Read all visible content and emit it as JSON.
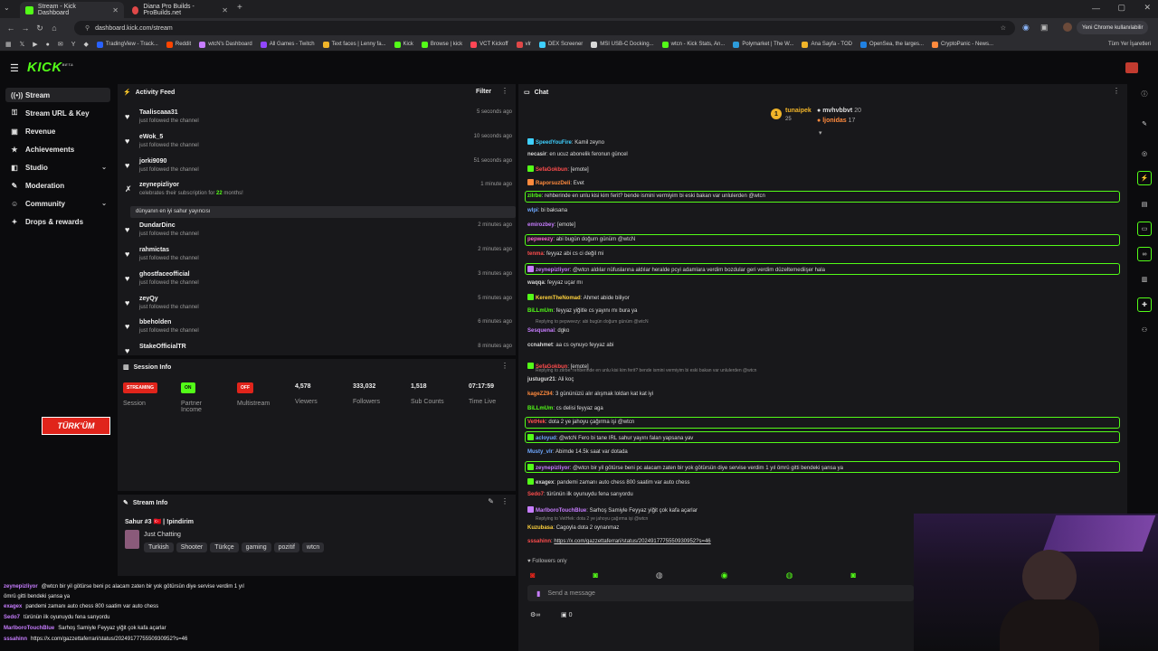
{
  "browser": {
    "tabs": [
      {
        "label": "Stream - Kick Dashboard",
        "active": true,
        "color": "#53fc18"
      },
      {
        "label": "Diana Pro Builds - ProBuilds.net",
        "active": false,
        "color": "#e04848"
      }
    ],
    "url": "dashboard.kick.com/stream",
    "profile_label": "Yeni Chrome kullanılabilir",
    "bookmarks": [
      "TradingView - Track...",
      "Reddit",
      "wtcN's Dashboard",
      "All Games - Twitch",
      "Text faces | Lenny fa...",
      "Kick",
      "Browse | kick",
      "VCT Kickoff",
      "vlr",
      "DEX Screener",
      "MSI USB-C Docking...",
      "wtcn - Kick Stats, An...",
      "Polymarket | The W...",
      "Ana Sayfa - TOD",
      "OpenSea, the larges...",
      "CryptoPanic - News..."
    ],
    "bookmarks_all": "Tüm Yer İşaretleri"
  },
  "app": {
    "logo": "KICK",
    "logo_sup": "BETA",
    "accent": "#53fc18"
  },
  "sidebar": {
    "items": [
      {
        "label": "Stream",
        "icon": "broadcast-icon",
        "glyph": "((•))",
        "selected": true
      },
      {
        "label": "Stream URL & Key",
        "icon": "key-icon",
        "glyph": "⚿"
      },
      {
        "label": "Revenue",
        "icon": "wallet-icon",
        "glyph": "▣"
      },
      {
        "label": "Achievements",
        "icon": "trophy-icon",
        "glyph": "★"
      },
      {
        "label": "Studio",
        "icon": "studio-icon",
        "glyph": "◧",
        "chevron": true
      },
      {
        "label": "Moderation",
        "icon": "sword-icon",
        "glyph": "✎"
      },
      {
        "label": "Community",
        "icon": "community-icon",
        "glyph": "☺",
        "chevron": true
      },
      {
        "label": "Drops & rewards",
        "icon": "gift-icon",
        "glyph": "✦"
      }
    ]
  },
  "activity_feed": {
    "title": "Activity Feed",
    "filter_label": "Filter",
    "entries": [
      {
        "name": "Taaliscaaa31",
        "sub": "just followed the channel",
        "time": "5 seconds ago"
      },
      {
        "name": "eWok_5",
        "sub": "just followed the channel",
        "time": "10 seconds ago"
      },
      {
        "name": "jorki9090",
        "sub": "just followed the channel",
        "time": "51 seconds ago"
      },
      {
        "name": "zeynepizliyor",
        "sub": "celebrates their subscription for",
        "sub_months": "22",
        "sub_suffix": "months!",
        "time": "1 minute ago",
        "message": "dünyanın en iyi sahur yayıncısı"
      },
      {
        "name": "DundarDinc",
        "sub": "just followed the channel",
        "time": "2 minutes ago"
      },
      {
        "name": "rahmictas",
        "sub": "just followed the channel",
        "time": "2 minutes ago"
      },
      {
        "name": "ghostfaceofficial",
        "sub": "just followed the channel",
        "time": "3 minutes ago"
      },
      {
        "name": "zeyQy",
        "sub": "just followed the channel",
        "time": "5 minutes ago"
      },
      {
        "name": "bbeholden",
        "sub": "just followed the channel",
        "time": "6 minutes ago"
      },
      {
        "name": "StakeOfficialTR",
        "sub": "",
        "time": "8 minutes ago"
      }
    ]
  },
  "session_info": {
    "title": "Session Info",
    "session": {
      "badge": "STREAMING",
      "label": "Session"
    },
    "partner": {
      "badge": "ON",
      "label": "Partner Income"
    },
    "multistream": {
      "badge": "OFF",
      "label": "Multistream"
    },
    "viewers": {
      "value": "4,578",
      "label": "Viewers"
    },
    "followers": {
      "value": "333,032",
      "label": "Followers"
    },
    "subs": {
      "value": "1,518",
      "label": "Sub Counts"
    },
    "time_live": {
      "value": "07:17:59",
      "label": "Time Live"
    }
  },
  "stream_info": {
    "title": "Stream Info",
    "stream_title": "Sahur #3 🇹🇷 | !pindirim",
    "category": "Just Chatting",
    "tags": [
      "Turkish",
      "Shooter",
      "Türkçe",
      "gaming",
      "pozitif",
      "wtcn"
    ]
  },
  "chat": {
    "title": "Chat",
    "top_gifters": [
      {
        "rank": "1",
        "name": "tunaipek",
        "count": "25"
      },
      {
        "name": "mvhvbbvt",
        "count": "20"
      },
      {
        "name": "ljonidas",
        "count": "17"
      }
    ],
    "messages": [
      {
        "user": "SpeedYouFire",
        "color": "#3fd0ff",
        "text": "Kamil zeyno"
      },
      {
        "user": "necasir",
        "color": "#d8d8d8",
        "text": "en ucuz abonelik feronun güncel"
      },
      {
        "user": "SefaGokbun",
        "color": "#ff4d4d",
        "text": "[emote]"
      },
      {
        "user": "RaporsuzDeli",
        "color": "#ff8a3d",
        "text": "Evet"
      },
      {
        "user": "zilrbe",
        "color": "#53fc18",
        "text": "rehberinde en unlu kisi kim ferit? bende ismini vermiyim bi eski bakan var unlulerden @wtcn",
        "highlight": true
      },
      {
        "user": "wlpi",
        "color": "#6fa8ff",
        "text": "bi baksana"
      },
      {
        "user": "emirozbey",
        "color": "#c77dff",
        "text": "[emote]"
      },
      {
        "user": "pepweezy",
        "color": "#ff66cc",
        "text": "abi bugün doğum günüm @wtcN",
        "highlight": true
      },
      {
        "user": "tenma",
        "color": "#ff4d4d",
        "text": "feyyaz abi cs ci değil mi"
      },
      {
        "user": "zeynepizliyor",
        "color": "#c77dff",
        "text": "@wtcn aldılar nüfuslarına aldılar heralde pcyi adamlara verdim bozdular geri verdim düzeltemediişer hala",
        "highlight": true
      },
      {
        "user": "waqqa",
        "color": "#d8d8d8",
        "text": "feyyaz uçar mı"
      },
      {
        "user": "KeremTheNomad",
        "color": "#ffd23d",
        "text": "Ahmet abide biliyor"
      },
      {
        "user": "BiLLmUm",
        "color": "#53fc18",
        "text": "feyyaz yiğitle cs yayını mı bura ya"
      },
      {
        "user": "Sesquenai",
        "color": "#c77dff",
        "text": "dgko",
        "reply": "Replying to pepweezy: abi bugün doğum günüm @wtcN"
      },
      {
        "user": "ccnahmet",
        "color": "#d8d8d8",
        "text": "aa cs oynuyo feyyaz abi"
      },
      {
        "user": "SefaGokbun",
        "color": "#ff4d4d",
        "text": "[emote]"
      },
      {
        "user": "justugur21",
        "color": "#d8d8d8",
        "text": "Ali koç",
        "reply": "Replying to zilrbe: rehberinde en unlu kisi kim ferit? bende ismini vermiyim bi eski bakan var unlulerden @wtcn"
      },
      {
        "user": "kageZZ94",
        "color": "#ff8a3d",
        "text": "3 gününüzü alır alışmak loldan kat kat iyi"
      },
      {
        "user": "BiLLmUm",
        "color": "#53fc18",
        "text": "cs delisi feyyaz aga"
      },
      {
        "user": "VetHek",
        "color": "#ff4d4d",
        "text": "dota 2 ye jahoyu çağırma işi @wtcn",
        "highlight": true
      },
      {
        "user": "acloyud",
        "color": "#6fa8ff",
        "text": "@wtcN Fero bi tane IRL sahur yayını falan yapsana yav",
        "highlight": true
      },
      {
        "user": "Musty_vlr",
        "color": "#6fa8ff",
        "text": "Abimde 14.5k saat var dotada"
      },
      {
        "user": "zeynepizliyor",
        "color": "#c77dff",
        "text": "@wtcn bir yil götürse beni pc alacam zaten bir yok götürsün diye servise verdim 1 yıl ömrü gitti bendeki şansa ya",
        "highlight": true
      },
      {
        "user": "exagex",
        "color": "#d8d8d8",
        "text": "pandemi zamanı auto chess 800 saatim var auto chess"
      },
      {
        "user": "Sedo7",
        "color": "#ff4d4d",
        "text": "türünün ilk oyunuydu fena sarıyordu"
      },
      {
        "user": "MarlboroTouchBlue",
        "color": "#c77dff",
        "text": "Sarhoş Samiyle Feyyaz yiğit çok kafa açarlar"
      },
      {
        "user": "Kuzubasa",
        "color": "#ffd23d",
        "text": "Cagoyla dota 2 oynanmaz",
        "reply": "Replying to VetHek: dota 2 ye jahoyu çağırma işi @wtcn"
      },
      {
        "user": "sssahinn",
        "color": "#ff4d4d",
        "text": "https://x.com/gazzettaferrari/status/2024917775550930952?s=46"
      }
    ],
    "followers_only": "Followers only",
    "input_placeholder": "Send a message",
    "footer_count": "0"
  },
  "overlay_chat": [
    {
      "user": "zeynepizliyor",
      "text": "@wtcn bir yil götürse beni pc alacam zaten bir yok götürsün diye servise verdim 1 yıl"
    },
    {
      "user": "",
      "text": "ömrü gitti bendeki şansa ya"
    },
    {
      "user": "exagex",
      "text": "pandemi zamanı auto chess 800 saatim var auto chess"
    },
    {
      "user": "Sedo7",
      "text": "türünün ilk oyunuydu fena sarıyordu"
    },
    {
      "user": "MarlboroTouchBlue",
      "text": "Sarhoş Samiyle Feyyaz yiğit çok kafa açarlar"
    },
    {
      "user": "sssahinn",
      "text": "https://x.com/gazzettaferrari/status/2024917775550930952?s=46"
    }
  ],
  "overlay_logo": "TÜRK'ÜM"
}
